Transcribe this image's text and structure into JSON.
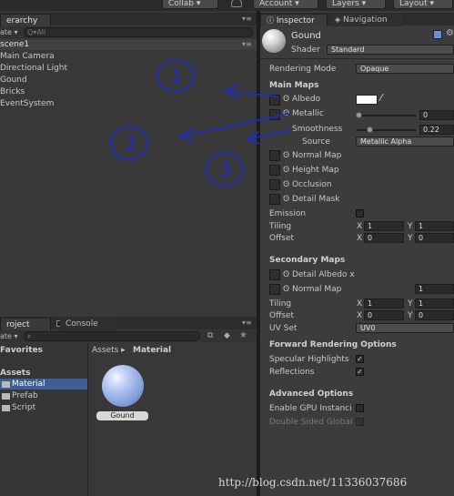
{
  "toolbar": {
    "collab": "Collab ▾",
    "account": "Account ▾",
    "layers": "Layers ▾",
    "layout": "Layout ▾"
  },
  "hierarchy": {
    "tab": "erarchy",
    "create": "ate ▾",
    "search_placeholder": "Q▾All",
    "scene": "scene1",
    "items": [
      "Main Camera",
      "Directional Light",
      "Gound",
      "Bricks",
      "EventSystem"
    ]
  },
  "project": {
    "tab": "roject",
    "console_tab": "Console",
    "create": "ate ▾",
    "favorites": "Favorites",
    "assets": "Assets",
    "folders": [
      "Material",
      "Prefab",
      "Script"
    ],
    "breadcrumb_root": "Assets ▸",
    "breadcrumb_current": "Material",
    "asset_name": "Gound"
  },
  "inspector": {
    "tab": "Inspector",
    "nav_tab": "Navigation",
    "material_name": "Gound",
    "shader_label": "Shader",
    "shader_value": "Standard",
    "rendering_mode_label": "Rendering Mode",
    "rendering_mode_value": "Opaque",
    "main_maps": "Main Maps",
    "albedo": "Albedo",
    "metallic": "Metallic",
    "metallic_value": "0",
    "smoothness": "Smoothness",
    "smoothness_value": "0.22",
    "smoothness_level": 0.22,
    "source_label": "Source",
    "source_value": "Metallic Alpha",
    "normal_map": "Normal Map",
    "height_map": "Height Map",
    "occlusion": "Occlusion",
    "detail_mask": "Detail Mask",
    "emission": "Emission",
    "tiling": "Tiling",
    "offset": "Offset",
    "x": "X",
    "y": "Y",
    "tiling_x": "1",
    "tiling_y": "1",
    "offset_x": "0",
    "offset_y": "0",
    "secondary_maps": "Secondary Maps",
    "detail_albedo": "Detail Albedo x",
    "sec_normal_map": "Normal Map",
    "sec_normal_value": "1",
    "sec_tiling_x": "1",
    "sec_tiling_y": "1",
    "sec_offset_x": "0",
    "sec_offset_y": "0",
    "uv_set_label": "UV Set",
    "uv_set_value": "UV0",
    "forward_rendering": "Forward Rendering Options",
    "specular_highlights": "Specular Highlights",
    "reflections": "Reflections",
    "advanced_options": "Advanced Options",
    "gpu_instancing": "Enable GPU Instanci",
    "double_sided": "Double Sided Global"
  },
  "annotations": {
    "circle1": "1",
    "circle2": "2",
    "circle3": "3"
  },
  "watermark": "http://blog.csdn.net/11336037686",
  "colors": {
    "annotation_ink": "#1a2bd6"
  }
}
